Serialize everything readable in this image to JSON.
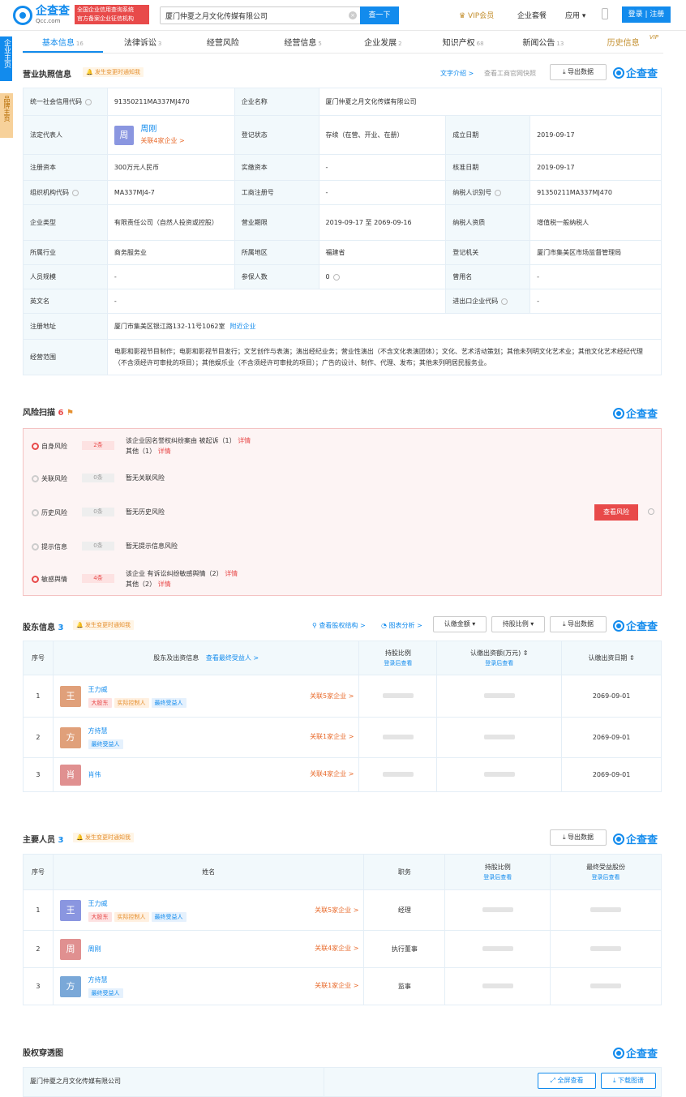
{
  "header": {
    "logo_name": "企查查",
    "logo_domain": "Qcc.com",
    "badge_line1": "全国企业信用查询系统",
    "badge_line2": "官方备案企业征信机构",
    "search_value": "厦门仲夏之月文化传媒有限公司",
    "search_button": "查一下",
    "vip": "VIP会员",
    "package": "企业套餐",
    "apps": "应用",
    "login": "登录 | 注册"
  },
  "side": {
    "main": "企业主页",
    "brand": "品牌主页"
  },
  "tabs": [
    {
      "label": "基本信息",
      "count": "16"
    },
    {
      "label": "法律诉讼",
      "count": "3"
    },
    {
      "label": "经营风险",
      "count": ""
    },
    {
      "label": "经营信息",
      "count": "5"
    },
    {
      "label": "企业发展",
      "count": "2"
    },
    {
      "label": "知识产权",
      "count": "68"
    },
    {
      "label": "新闻公告",
      "count": "13"
    },
    {
      "label": "历史信息",
      "count": ""
    }
  ],
  "vip_tag": "VIP",
  "biz": {
    "title": "营业执照信息",
    "notify": "发生变更时通知我",
    "text_intro": "文字介绍 >",
    "snapshot": "查看工商官网快照",
    "export": "导出数据",
    "brand": "企查查",
    "rows": {
      "credit_code_k": "统一社会信用代码",
      "credit_code_v": "91350211MA337MJ470",
      "name_k": "企业名称",
      "name_v": "厦门仲夏之月文化传媒有限公司",
      "legal_k": "法定代表人",
      "legal_avatar": "周",
      "legal_name": "周刚",
      "legal_link": "关联4家企业 >",
      "status_k": "登记状态",
      "status_v": "存续（在营、开业、在册）",
      "est_k": "成立日期",
      "est_v": "2019-09-17",
      "capital_k": "注册资本",
      "capital_v": "300万元人民币",
      "paid_k": "实缴资本",
      "paid_v": "-",
      "approve_k": "核准日期",
      "approve_v": "2019-09-17",
      "org_k": "组织机构代码",
      "org_v": "MA337MJ4-7",
      "reg_k": "工商注册号",
      "reg_v": "-",
      "tax_k": "纳税人识别号",
      "tax_v": "91350211MA337MJ470",
      "type_k": "企业类型",
      "type_v": "有限责任公司（自然人投资或控股）",
      "term_k": "营业期限",
      "term_v": "2019-09-17 至 2069-09-16",
      "taxq_k": "纳税人资质",
      "taxq_v": "增值税一般纳税人",
      "ind_k": "所属行业",
      "ind_v": "商务服务业",
      "region_k": "所属地区",
      "region_v": "福建省",
      "auth_k": "登记机关",
      "auth_v": "厦门市集美区市场监督管理局",
      "staff_k": "人员规模",
      "staff_v": "-",
      "ins_k": "参保人数",
      "ins_v": "0",
      "former_k": "曾用名",
      "former_v": "-",
      "en_k": "英文名",
      "en_v": "-",
      "ie_k": "进出口企业代码",
      "ie_v": "-",
      "addr_k": "注册地址",
      "addr_v": "厦门市集美区银江路132-11号1062室",
      "addr_link": "附近企业",
      "scope_k": "经营范围",
      "scope_v": "电影和影视节目制作；电影和影视节目发行；文艺创作与表演；演出经纪业务；营业性演出（不含文化表演团体）；文化、艺术活动策划；其他未列明文化艺术业；其他文化艺术经纪代理（不含须经许可审批的项目）；其他娱乐业（不含须经许可审批的项目）；广告的设计、制作、代理、发布；其他未列明居民服务业。"
    }
  },
  "risk": {
    "title": "风险扫描",
    "count": "6",
    "brand": "企查查",
    "view_button": "查看风险",
    "rows": [
      {
        "label": "自身风险",
        "count": "2条",
        "l1": "该企业因名誉权纠纷案由 被起诉（1）",
        "l1_link": "详情",
        "l2": "其他（1）",
        "l2_link": "详情"
      },
      {
        "label": "关联风险",
        "count": "0条",
        "l1": "暂无关联风险"
      },
      {
        "label": "历史风险",
        "count": "0条",
        "l1": "暂无历史风险"
      },
      {
        "label": "提示信息",
        "count": "0条",
        "l1": "暂无提示信息风险"
      },
      {
        "label": "敏感舆情",
        "count": "4条",
        "l1": "该企业 有诉讼纠纷敏感舆情（2）",
        "l1_link": "详情",
        "l2": "其他（2）",
        "l2_link": "详情"
      }
    ]
  },
  "shareholders": {
    "title": "股东信息",
    "count": "3",
    "notify": "发生变更时通知我",
    "structure": "查看股权结构 >",
    "chart": "图表分析 >",
    "amount_sel": "认缴金额",
    "ratio_sel": "持股比例",
    "export": "导出数据",
    "brand": "企查查",
    "h_no": "序号",
    "h_name": "股东及出资信息",
    "h_name_link": "查看最终受益人 >",
    "h_ratio": "持股比例",
    "h_amount": "认缴出资额(万元)",
    "h_date": "认缴出资日期",
    "login_view": "登录后查看",
    "rows": [
      {
        "no": "1",
        "avatar": "王",
        "name": "王力威",
        "tags": [
          "大股东",
          "实际控制人",
          "最终受益人"
        ],
        "link": "关联5家企业 >",
        "date": "2069-09-01"
      },
      {
        "no": "2",
        "avatar": "方",
        "name": "方持慧",
        "tags": [
          "最终受益人"
        ],
        "link": "关联1家企业 >",
        "date": "2069-09-01"
      },
      {
        "no": "3",
        "avatar": "肖",
        "name": "肖伟",
        "tags": [],
        "link": "关联4家企业 >",
        "date": "2069-09-01"
      }
    ]
  },
  "people": {
    "title": "主要人员",
    "count": "3",
    "notify": "发生变更时通知我",
    "export": "导出数据",
    "brand": "企查查",
    "h_no": "序号",
    "h_name": "姓名",
    "h_role": "职务",
    "h_ratio": "持股比例",
    "h_benefit": "最终受益股份",
    "login_view": "登录后查看",
    "rows": [
      {
        "no": "1",
        "avatar": "王",
        "name": "王力威",
        "tags": [
          "大股东",
          "实际控制人",
          "最终受益人"
        ],
        "link": "关联5家企业 >",
        "role": "经理"
      },
      {
        "no": "2",
        "avatar": "周",
        "name": "周刚",
        "tags": [],
        "link": "关联4家企业 >",
        "role": "执行董事"
      },
      {
        "no": "3",
        "avatar": "方",
        "name": "方持慧",
        "tags": [
          "最终受益人"
        ],
        "link": "关联1家企业 >",
        "role": "监事"
      }
    ]
  },
  "penetration": {
    "title": "股权穿透图",
    "brand": "企查查",
    "company": "厦门仲夏之月文化传媒有限公司",
    "fullscreen": "全屏查看",
    "download": "下载图谱"
  },
  "colors": {
    "accent": "#128bed",
    "danger": "#e84a4a",
    "warn": "#e59030"
  }
}
